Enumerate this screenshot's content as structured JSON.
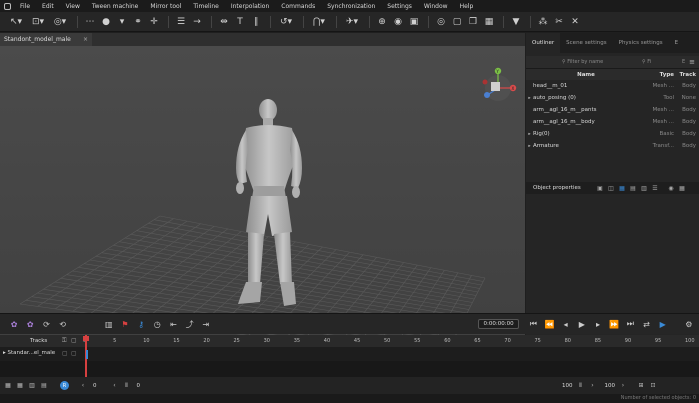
{
  "menu": [
    "File",
    "Edit",
    "View",
    "Tween machine",
    "Mirror tool",
    "Timeline",
    "Interpolation",
    "Commands",
    "Synchronization",
    "Settings",
    "Window",
    "Help"
  ],
  "viewport": {
    "tab_label": "Standont_model_male",
    "close": "×",
    "gizmo_axes": [
      "Y",
      "X"
    ]
  },
  "outliner": {
    "tabs": [
      "Outliner",
      "Scene settings",
      "Physics settings",
      "E"
    ],
    "filter_name": "Filter by name",
    "filter_type": "Fi",
    "filter_track": "E",
    "columns": {
      "name": "Name",
      "type": "Type",
      "track": "Track"
    },
    "rows": [
      {
        "arrow": "",
        "name": "head__m_01",
        "type": "Mesh ...",
        "track": "Body"
      },
      {
        "arrow": "▸",
        "name": "auto_posing (0)",
        "type": "Tool",
        "track": "None"
      },
      {
        "arrow": "",
        "name": "arm__agl_16_m__pants",
        "type": "Mesh ...",
        "track": "Body"
      },
      {
        "arrow": "",
        "name": "arm__agl_16_m__body",
        "type": "Mesh ...",
        "track": "Body"
      },
      {
        "arrow": "▸",
        "name": "Rig(0)",
        "type": "Basic",
        "track": "Body"
      },
      {
        "arrow": "▸",
        "name": "Armature",
        "type": "Transf...",
        "track": "Body"
      }
    ],
    "object_properties": "Object properties"
  },
  "timeline": {
    "time": "0:00:00:00",
    "tracks_label": "Tracks",
    "track_name": "Standar...el_male",
    "ticks": [
      "0",
      "5",
      "10",
      "15",
      "20",
      "25",
      "30",
      "35",
      "40",
      "45",
      "50",
      "55",
      "60",
      "65",
      "70",
      "75",
      "80",
      "85",
      "90",
      "95",
      "100"
    ]
  },
  "bottom": {
    "frame_start": "0",
    "frame_current": "0",
    "range_end": "100",
    "range_end2": "100"
  },
  "status": "Number of selected objects: 0",
  "colors": {
    "accent": "#3a8ad6",
    "playhead": "#d64040"
  }
}
